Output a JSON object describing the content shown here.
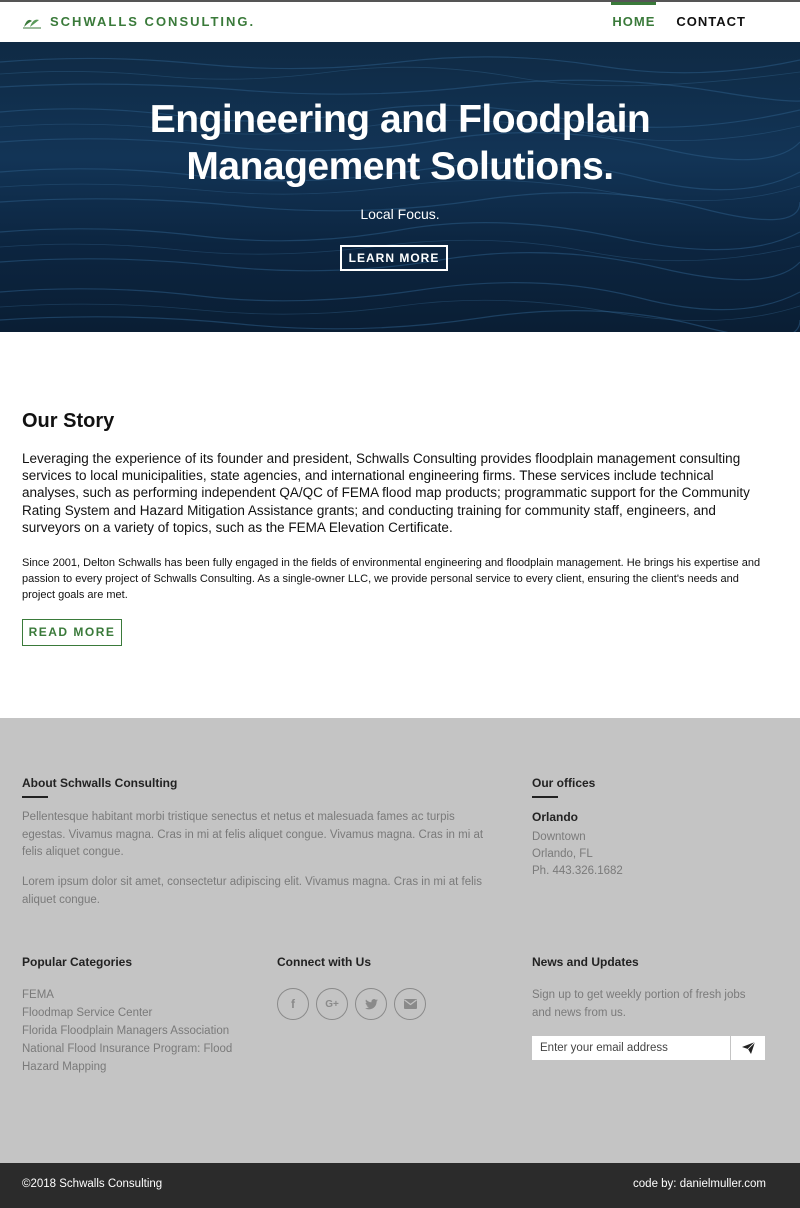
{
  "header": {
    "brand": "SCHWALLS CONSULTING.",
    "nav": [
      {
        "label": "HOME",
        "active": true
      },
      {
        "label": "CONTACT",
        "active": false
      }
    ]
  },
  "hero": {
    "title_line1": "Engineering and Floodplain",
    "title_line2": "Management Solutions.",
    "subtitle": "Local Focus.",
    "button_label": "LEARN MORE"
  },
  "story": {
    "title": "Our Story",
    "paragraph1": "Leveraging the experience of its founder and president, Schwalls Consulting provides floodplain management consulting services to local municipalities, state agencies, and international engineering firms. These services include technical analyses, such as performing independent QA/QC of FEMA flood map products; programmatic support for the Community Rating System and Hazard Mitigation Assistance grants; and conducting training for community staff, engineers, and surveyors on a variety of topics, such as the FEMA Elevation Certificate.",
    "paragraph2": "Since 2001, Delton Schwalls has been fully engaged in the fields of environmental engineering and floodplain management. He brings his expertise and passion to every project of Schwalls Consulting. As a single-owner LLC, we provide personal service to every client, ensuring the client's needs and project goals are met.",
    "button_label": "READ MORE"
  },
  "footer": {
    "about": {
      "heading": "About Schwalls Consulting",
      "p1": "Pellentesque habitant morbi tristique senectus et netus et malesuada fames ac turpis egestas. Vivamus magna. Cras in mi at felis aliquet congue. Vivamus magna. Cras in mi at felis aliquet congue.",
      "p2": "Lorem ipsum dolor sit amet, consectetur adipiscing elit. Vivamus magna. Cras in mi at felis aliquet congue."
    },
    "offices": {
      "heading": "Our offices",
      "city": "Orlando",
      "line1": "Downtown",
      "line2": "Orlando, FL",
      "phone": "Ph. 443.326.1682"
    },
    "categories": {
      "heading": "Popular Categories",
      "links": [
        "FEMA",
        "Floodmap Service Center",
        "Florida Floodplain Managers Association",
        "National Flood Insurance Program: Flood Hazard Mapping"
      ]
    },
    "connect": {
      "heading": "Connect with Us",
      "icons": [
        "facebook-icon",
        "google-plus-icon",
        "twitter-icon",
        "email-icon"
      ]
    },
    "news": {
      "heading": "News and Updates",
      "text": "Sign up to get weekly portion of fresh jobs and news from us.",
      "email_placeholder": "Enter your email address"
    }
  },
  "bottom": {
    "copyright": "©2018 Schwalls Consulting",
    "credit": "code by: danielmuller.com"
  },
  "colors": {
    "brand_green": "#3a7a3a",
    "footer_bg": "#c4c4c4",
    "bottom_bar": "#2b2b2b",
    "hero_water": "#123456"
  }
}
